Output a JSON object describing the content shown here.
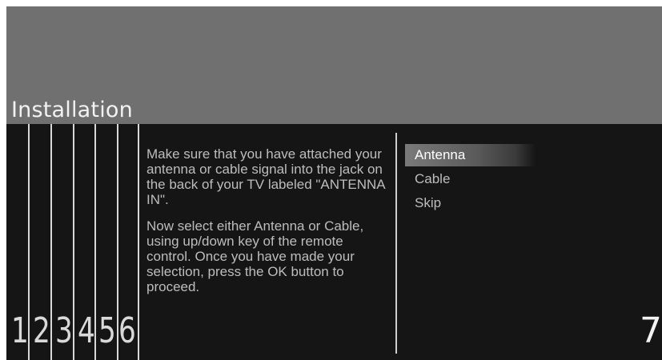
{
  "header": {
    "title": "Installation"
  },
  "steps": [
    "1",
    "2",
    "3",
    "4",
    "5",
    "6"
  ],
  "instructions": {
    "paragraph_1": "Make sure that you have attached your antenna or cable signal into the jack on the back of your TV labeled \"ANTENNA IN\".",
    "paragraph_2": "Now select either Antenna or Cable, using up/down key of the remote control. Once you have made your selection, press the OK button to proceed."
  },
  "menu": {
    "selected": "Antenna",
    "items": [
      {
        "label": "Antenna"
      },
      {
        "label": "Cable"
      },
      {
        "label": "Skip"
      }
    ]
  },
  "page_number": "7",
  "colors": {
    "header_bg": "#707070",
    "screen_bg": "#151515",
    "text": "#bdbdbd",
    "title": "#f2f2f2"
  }
}
